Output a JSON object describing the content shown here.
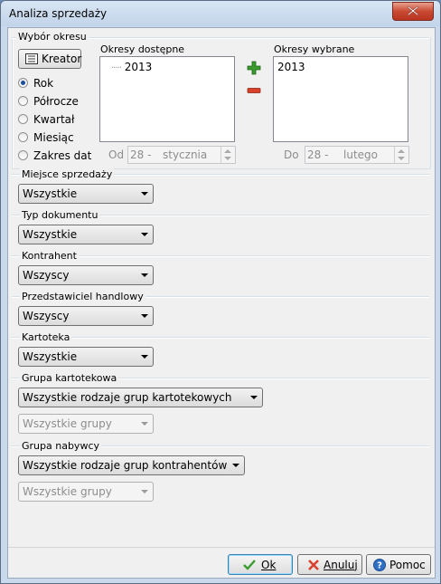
{
  "window": {
    "title": "Analiza sprzedaży"
  },
  "period": {
    "group_label": "Wybór okresu",
    "kreator_label": "Kreator",
    "radios": [
      {
        "label": "Rok",
        "checked": true
      },
      {
        "label": "Półrocze",
        "checked": false
      },
      {
        "label": "Kwartał",
        "checked": false
      },
      {
        "label": "Miesiąc",
        "checked": false
      },
      {
        "label": "Zakres dat",
        "checked": false
      }
    ],
    "available_label": "Okresy dostępne",
    "available_items": [
      "2013"
    ],
    "selected_label": "Okresy wybrane",
    "selected_items": [
      "2013"
    ],
    "from_label": "Od",
    "from_day": "28 -",
    "from_month": "stycznia",
    "to_label": "Do",
    "to_day": "28 -",
    "to_month": "lutego"
  },
  "filters": {
    "miejsce": {
      "label": "Miejsce sprzedaży",
      "value": "Wszystkie"
    },
    "typ": {
      "label": "Typ dokumentu",
      "value": "Wszystkie"
    },
    "kontrahent": {
      "label": "Kontrahent",
      "value": "Wszyscy"
    },
    "przedstawiciel": {
      "label": "Przedstawiciel handlowy",
      "value": "Wszyscy"
    },
    "kartoteka": {
      "label": "Kartoteka",
      "value": "Wszystkie"
    },
    "grupa_kart": {
      "label": "Grupa kartotekowa",
      "value": "Wszystkie rodzaje grup kartotekowych",
      "sub_value": "Wszystkie grupy"
    },
    "grupa_nab": {
      "label": "Grupa nabywcy",
      "value": "Wszystkie rodzaje grup kontrahentów",
      "sub_value": "Wszystkie grupy"
    }
  },
  "buttons": {
    "ok": "Ok",
    "cancel": "Anuluj",
    "help": "Pomoc"
  },
  "colors": {
    "add_icon": "#3a9b2f",
    "remove_icon": "#d9412b",
    "radio_dot": "#1e4f9c"
  }
}
